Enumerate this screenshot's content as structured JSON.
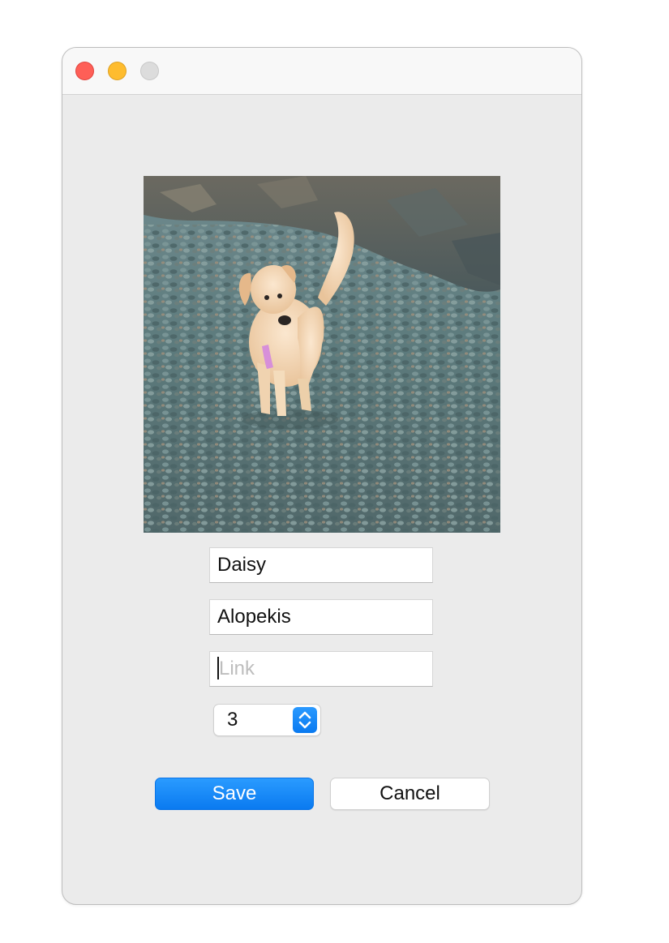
{
  "window": {
    "controls": {
      "close": "close-icon",
      "minimize": "minimize-icon",
      "zoom": "zoom-icon"
    }
  },
  "form": {
    "name_value": "Daisy",
    "breed_value": "Alopekis",
    "link_value": "",
    "link_placeholder": "Link",
    "stepper_value": "3",
    "stepper_icon": "chevron-up-down-icon"
  },
  "buttons": {
    "save_label": "Save",
    "cancel_label": "Cancel"
  },
  "colors": {
    "accent": "#0a7af0",
    "window_background": "#ebebeb",
    "close": "#fe5f57",
    "minimize": "#febc2e",
    "zoom_inactive": "#dcdcdc"
  }
}
